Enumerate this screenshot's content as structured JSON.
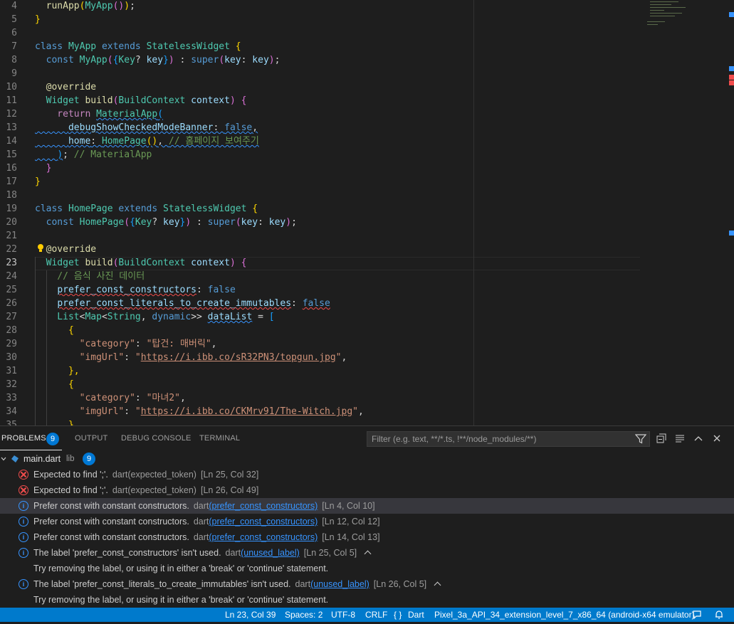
{
  "editor": {
    "current_line": "23",
    "lines": [
      {
        "n": "4",
        "t": [
          [
            "  ",
            "pl"
          ],
          [
            "runApp",
            "fn"
          ],
          [
            "(",
            "br1"
          ],
          [
            "MyApp",
            "cls"
          ],
          [
            "(",
            "br2"
          ],
          [
            ")",
            "br2"
          ],
          [
            ")",
            "br1"
          ],
          [
            ";",
            "pl"
          ]
        ]
      },
      {
        "n": "5",
        "t": [
          [
            "}",
            "br1"
          ]
        ]
      },
      {
        "n": "6",
        "t": []
      },
      {
        "n": "7",
        "t": [
          [
            "class ",
            "kw"
          ],
          [
            "MyApp ",
            "cls"
          ],
          [
            "extends ",
            "kw"
          ],
          [
            "StatelessWidget ",
            "cls"
          ],
          [
            "{",
            "br1"
          ]
        ]
      },
      {
        "n": "8",
        "t": [
          [
            "  const ",
            "kw"
          ],
          [
            "MyApp",
            "cls"
          ],
          [
            "(",
            "br2"
          ],
          [
            "{",
            "br3"
          ],
          [
            "Key",
            "cls"
          ],
          [
            "? ",
            "pl"
          ],
          [
            "key",
            "var"
          ],
          [
            "}",
            "br3"
          ],
          [
            ")",
            "br2"
          ],
          [
            " : ",
            "pl"
          ],
          [
            "super",
            "kw"
          ],
          [
            "(",
            "br2"
          ],
          [
            "key",
            "var"
          ],
          [
            ": ",
            "pl"
          ],
          [
            "key",
            "var"
          ],
          [
            ")",
            "br2"
          ],
          [
            ";",
            "pl"
          ]
        ]
      },
      {
        "n": "9",
        "t": []
      },
      {
        "n": "10",
        "t": [
          [
            "  @override",
            "fn"
          ]
        ]
      },
      {
        "n": "11",
        "t": [
          [
            "  Widget ",
            "cls"
          ],
          [
            "build",
            "fn"
          ],
          [
            "(",
            "br2"
          ],
          [
            "BuildContext ",
            "cls"
          ],
          [
            "context",
            "var"
          ],
          [
            ") ",
            "br2"
          ],
          [
            "{",
            "br2"
          ]
        ]
      },
      {
        "n": "12",
        "t": [
          [
            "    return ",
            "ctl"
          ],
          [
            "MaterialApp",
            "cls sq-blue"
          ],
          [
            "(",
            "br3 sq-blue"
          ]
        ]
      },
      {
        "n": "13",
        "t": [
          [
            "      ",
            "pl sq-blue"
          ],
          [
            "debugShowCheckedModeBanner",
            "var sq-blue"
          ],
          [
            ": ",
            "pl sq-blue"
          ],
          [
            "false",
            "kw sq-blue"
          ],
          [
            ",",
            "pl sq-blue"
          ]
        ]
      },
      {
        "n": "14",
        "t": [
          [
            "      ",
            "pl sq-blue"
          ],
          [
            "home",
            "var sq-blue"
          ],
          [
            ": ",
            "pl sq-blue"
          ],
          [
            "HomePage",
            "cls sq-blue"
          ],
          [
            "()",
            "br1 sq-blue"
          ],
          [
            ", ",
            "pl sq-blue"
          ],
          [
            "// 홈페이지 보여주기",
            "com sq-blue"
          ]
        ]
      },
      {
        "n": "15",
        "t": [
          [
            "    ",
            "pl sq-blue"
          ],
          [
            ")",
            "br3 sq-blue"
          ],
          [
            "; ",
            "pl"
          ],
          [
            "// MaterialApp",
            "com"
          ]
        ]
      },
      {
        "n": "16",
        "t": [
          [
            "  }",
            "br2"
          ]
        ]
      },
      {
        "n": "17",
        "t": [
          [
            "}",
            "br1"
          ]
        ]
      },
      {
        "n": "18",
        "t": []
      },
      {
        "n": "19",
        "t": [
          [
            "class ",
            "kw"
          ],
          [
            "HomePage ",
            "cls"
          ],
          [
            "extends ",
            "kw"
          ],
          [
            "StatelessWidget ",
            "cls"
          ],
          [
            "{",
            "br1"
          ]
        ]
      },
      {
        "n": "20",
        "t": [
          [
            "  const ",
            "kw"
          ],
          [
            "HomePage",
            "cls"
          ],
          [
            "(",
            "br2"
          ],
          [
            "{",
            "br3"
          ],
          [
            "Key",
            "cls"
          ],
          [
            "? ",
            "pl"
          ],
          [
            "key",
            "var"
          ],
          [
            "}",
            "br3"
          ],
          [
            ")",
            "br2"
          ],
          [
            " : ",
            "pl"
          ],
          [
            "super",
            "kw"
          ],
          [
            "(",
            "br2"
          ],
          [
            "key",
            "var"
          ],
          [
            ": ",
            "pl"
          ],
          [
            "key",
            "var"
          ],
          [
            ")",
            "br2"
          ],
          [
            ";",
            "pl"
          ]
        ]
      },
      {
        "n": "21",
        "t": []
      },
      {
        "n": "22",
        "t": [
          [
            "  @override",
            "fn"
          ]
        ]
      },
      {
        "n": "23",
        "t": [
          [
            "  Widget ",
            "cls"
          ],
          [
            "build",
            "fn"
          ],
          [
            "(",
            "br2"
          ],
          [
            "BuildContext ",
            "cls"
          ],
          [
            "context",
            "var"
          ],
          [
            ") ",
            "br2"
          ],
          [
            "{",
            "br2"
          ]
        ]
      },
      {
        "n": "24",
        "t": [
          [
            "    // 음식 사진 데이터",
            "com"
          ]
        ]
      },
      {
        "n": "25",
        "t": [
          [
            "    ",
            "pl"
          ],
          [
            "prefer_const_constructors",
            "var sq-red"
          ],
          [
            ": ",
            "pl"
          ],
          [
            "false",
            "kw"
          ]
        ]
      },
      {
        "n": "26",
        "t": [
          [
            "    ",
            "pl"
          ],
          [
            "prefer_const_literals_to_create_immutables",
            "var sq-red"
          ],
          [
            ": ",
            "pl"
          ],
          [
            "false",
            "kw sq-red"
          ]
        ]
      },
      {
        "n": "27",
        "t": [
          [
            "    List",
            "cls"
          ],
          [
            "<",
            "pl"
          ],
          [
            "Map",
            "cls"
          ],
          [
            "<",
            "pl"
          ],
          [
            "String",
            "cls"
          ],
          [
            ", ",
            "pl"
          ],
          [
            "dynamic",
            "kw"
          ],
          [
            ">> ",
            "pl"
          ],
          [
            "dataList",
            "var sq-blue"
          ],
          [
            " = ",
            "pl"
          ],
          [
            "[",
            "br3"
          ]
        ]
      },
      {
        "n": "28",
        "t": [
          [
            "      {",
            "br1"
          ]
        ]
      },
      {
        "n": "29",
        "t": [
          [
            "        ",
            "pl"
          ],
          [
            "\"category\"",
            "str"
          ],
          [
            ": ",
            "pl"
          ],
          [
            "\"탑건: 매버릭\"",
            "str"
          ],
          [
            ",",
            "pl"
          ]
        ]
      },
      {
        "n": "30",
        "t": [
          [
            "        ",
            "pl"
          ],
          [
            "\"imgUrl\"",
            "str"
          ],
          [
            ": ",
            "pl"
          ],
          [
            "\"",
            "str"
          ],
          [
            "https://i.ibb.co/sR32PN3/topgun.jpg",
            "url"
          ],
          [
            "\"",
            "str"
          ],
          [
            ",",
            "pl"
          ]
        ]
      },
      {
        "n": "31",
        "t": [
          [
            "      },",
            "br1"
          ]
        ]
      },
      {
        "n": "32",
        "t": [
          [
            "      {",
            "br1"
          ]
        ]
      },
      {
        "n": "33",
        "t": [
          [
            "        ",
            "pl"
          ],
          [
            "\"category\"",
            "str"
          ],
          [
            ": ",
            "pl"
          ],
          [
            "\"마녀2\"",
            "str"
          ],
          [
            ",",
            "pl"
          ]
        ]
      },
      {
        "n": "34",
        "t": [
          [
            "        ",
            "pl"
          ],
          [
            "\"imgUrl\"",
            "str"
          ],
          [
            ": ",
            "pl"
          ],
          [
            "\"",
            "str"
          ],
          [
            "https://i.ibb.co/CKMrv91/The-Witch.jpg",
            "url"
          ],
          [
            "\"",
            "str"
          ],
          [
            ",",
            "pl"
          ]
        ]
      },
      {
        "n": "35",
        "t": [
          [
            "      },",
            "br1"
          ]
        ]
      }
    ]
  },
  "panel": {
    "tabs": [
      "PROBLEMS",
      "OUTPUT",
      "DEBUG CONSOLE",
      "TERMINAL"
    ],
    "problems_count": "9",
    "filter_placeholder": "Filter (e.g. text, **/*.ts, !**/node_modules/**)",
    "file": {
      "name": "main.dart",
      "folder": "lib",
      "count": "9"
    },
    "problems": [
      {
        "type": "error",
        "msg": "Expected to find ';'.",
        "src": "dart",
        "code": "expected_token",
        "link": false,
        "loc": "[Ln 25, Col 32]"
      },
      {
        "type": "error",
        "msg": "Expected to find ';'.",
        "src": "dart",
        "code": "expected_token",
        "link": false,
        "loc": "[Ln 26, Col 49]"
      },
      {
        "type": "info",
        "msg": "Prefer const with constant constructors.",
        "src": "dart",
        "code": "prefer_const_constructors",
        "link": true,
        "loc": "[Ln 4, Col 10]",
        "selected": true
      },
      {
        "type": "info",
        "msg": "Prefer const with constant constructors.",
        "src": "dart",
        "code": "prefer_const_constructors",
        "link": true,
        "loc": "[Ln 12, Col 12]"
      },
      {
        "type": "info",
        "msg": "Prefer const with constant constructors.",
        "src": "dart",
        "code": "prefer_const_constructors",
        "link": true,
        "loc": "[Ln 14, Col 13]"
      },
      {
        "type": "info",
        "msg": "The label 'prefer_const_constructors' isn't used.",
        "src": "dart",
        "code": "unused_label",
        "link": true,
        "loc": "[Ln 25, Col 5]",
        "expand": true
      },
      {
        "type": "hint",
        "msg": "Try removing the label, or using it in either a 'break' or 'continue' statement."
      },
      {
        "type": "info",
        "msg": "The label 'prefer_const_literals_to_create_immutables' isn't used.",
        "src": "dart",
        "code": "unused_label",
        "link": true,
        "loc": "[Ln 26, Col 5]",
        "expand": true
      },
      {
        "type": "hint",
        "msg": "Try removing the label, or using it in either a 'break' or 'continue' statement."
      }
    ]
  },
  "status": {
    "position": "Ln 23, Col 39",
    "spaces": "Spaces: 2",
    "encoding": "UTF-8",
    "eol": "CRLF",
    "language": "Dart",
    "language_icon": "{ }",
    "device": "Pixel_3a_API_34_extension_level_7_x86_64 (android-x64 emulator)"
  }
}
